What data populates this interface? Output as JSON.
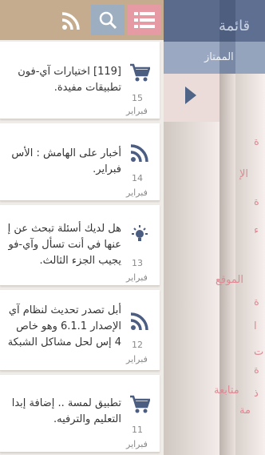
{
  "side_menu": {
    "title": "قائمة",
    "subtitle": "الممتاز",
    "items": [
      "ة",
      "الإ",
      "ة",
      "ء",
      "الموقع",
      "ة",
      "ا",
      "ت",
      "ة",
      "ذ",
      "متابعة",
      "مة"
    ]
  },
  "toolbar": {
    "rss_icon": "rss-icon",
    "search_icon": "search-icon",
    "menu_icon": "menu-icon"
  },
  "articles": [
    {
      "icon": "cart-icon",
      "line1": "[119] اختيارات آي-فون",
      "line2": "تطبيقات مفيدة.",
      "day": "15",
      "month": "فبراير"
    },
    {
      "icon": "rss-icon",
      "line1": "أخبار على الهامش : الأس",
      "line2": "فبراير.",
      "day": "14",
      "month": "فبراير"
    },
    {
      "icon": "bulb-icon",
      "line1": "هل لديك أسئلة تبحث عن إ",
      "line2": "عنها في أنت تسأل وآي-فو",
      "line3": "يجيب الجزء الثالث.",
      "day": "13",
      "month": "فبراير"
    },
    {
      "icon": "rss-icon",
      "line1": "أبل تصدر تحديث لنظام آي",
      "line2": "الإصدار 6.1.1 وهو خاص",
      "line3": "4 إس لحل مشاكل الشبكة",
      "day": "12",
      "month": "فبراير"
    },
    {
      "icon": "cart-icon",
      "line1": "تطبيق لمسة .. إضافة إبدا",
      "line2": "التعليم والترفيه.",
      "day": "11",
      "month": "فبراير"
    }
  ]
}
